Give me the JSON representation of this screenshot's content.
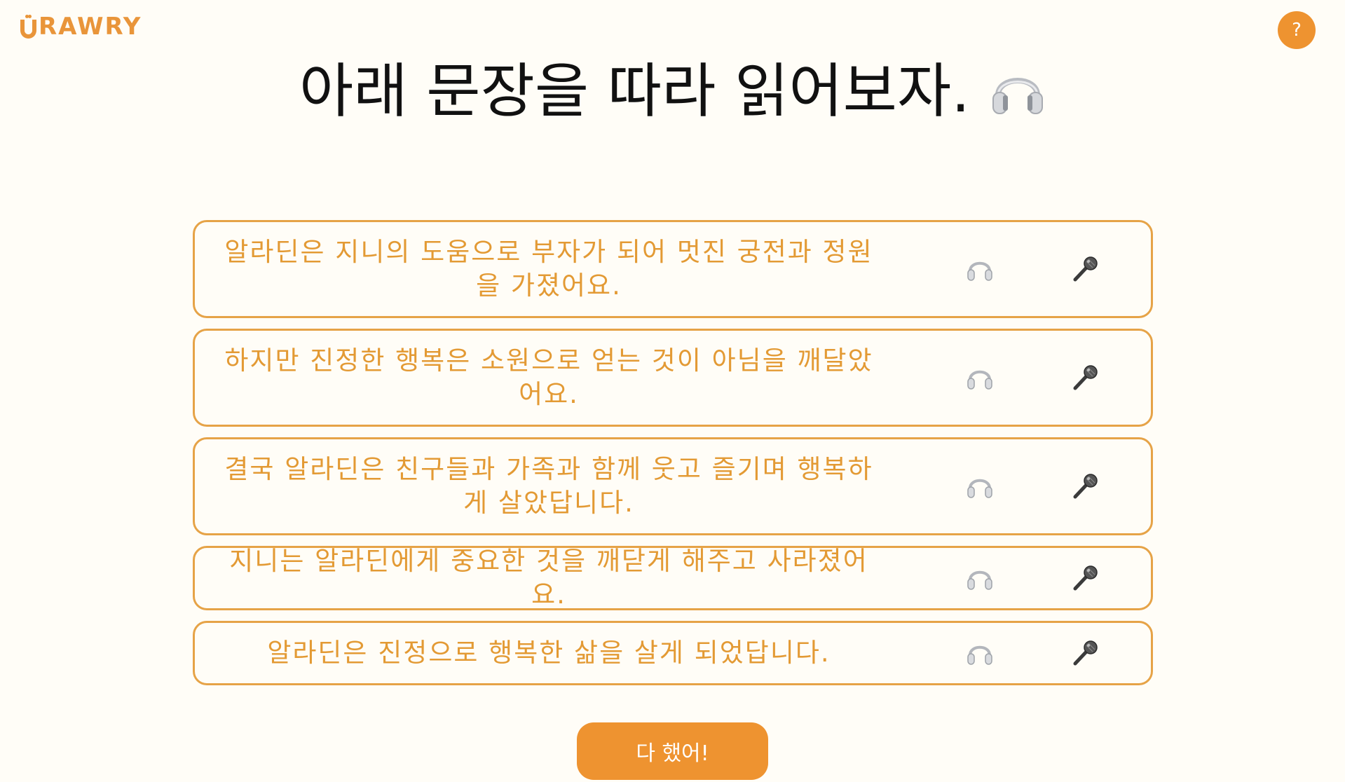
{
  "brand": {
    "logo_text": "RAWRY",
    "accent_color": "#ee9330"
  },
  "header": {
    "help_label": "?"
  },
  "main": {
    "title": "아래 문장을 따라 읽어보자.",
    "title_icon": "headphones-icon"
  },
  "sentences": [
    {
      "text": "알라딘은 지니의 도움으로 부자가 되어 멋진 궁전과 정원을 가졌어요.",
      "listen_icon": "headphones-icon",
      "record_icon": "microphone-icon"
    },
    {
      "text": "하지만 진정한 행복은 소원으로 얻는 것이 아님을 깨달았어요.",
      "listen_icon": "headphones-icon",
      "record_icon": "microphone-icon"
    },
    {
      "text": "결국 알라딘은 친구들과 가족과 함께 웃고 즐기며 행복하게 살았답니다.",
      "listen_icon": "headphones-icon",
      "record_icon": "microphone-icon"
    },
    {
      "text": "지니는 알라딘에게 중요한 것을 깨닫게 해주고 사라졌어요.",
      "listen_icon": "headphones-icon",
      "record_icon": "microphone-icon"
    },
    {
      "text": "알라딘은 진정으로 행복한 삶을 살게 되었답니다.",
      "listen_icon": "headphones-icon",
      "record_icon": "microphone-icon"
    }
  ],
  "footer": {
    "done_label": "다 했어!"
  }
}
